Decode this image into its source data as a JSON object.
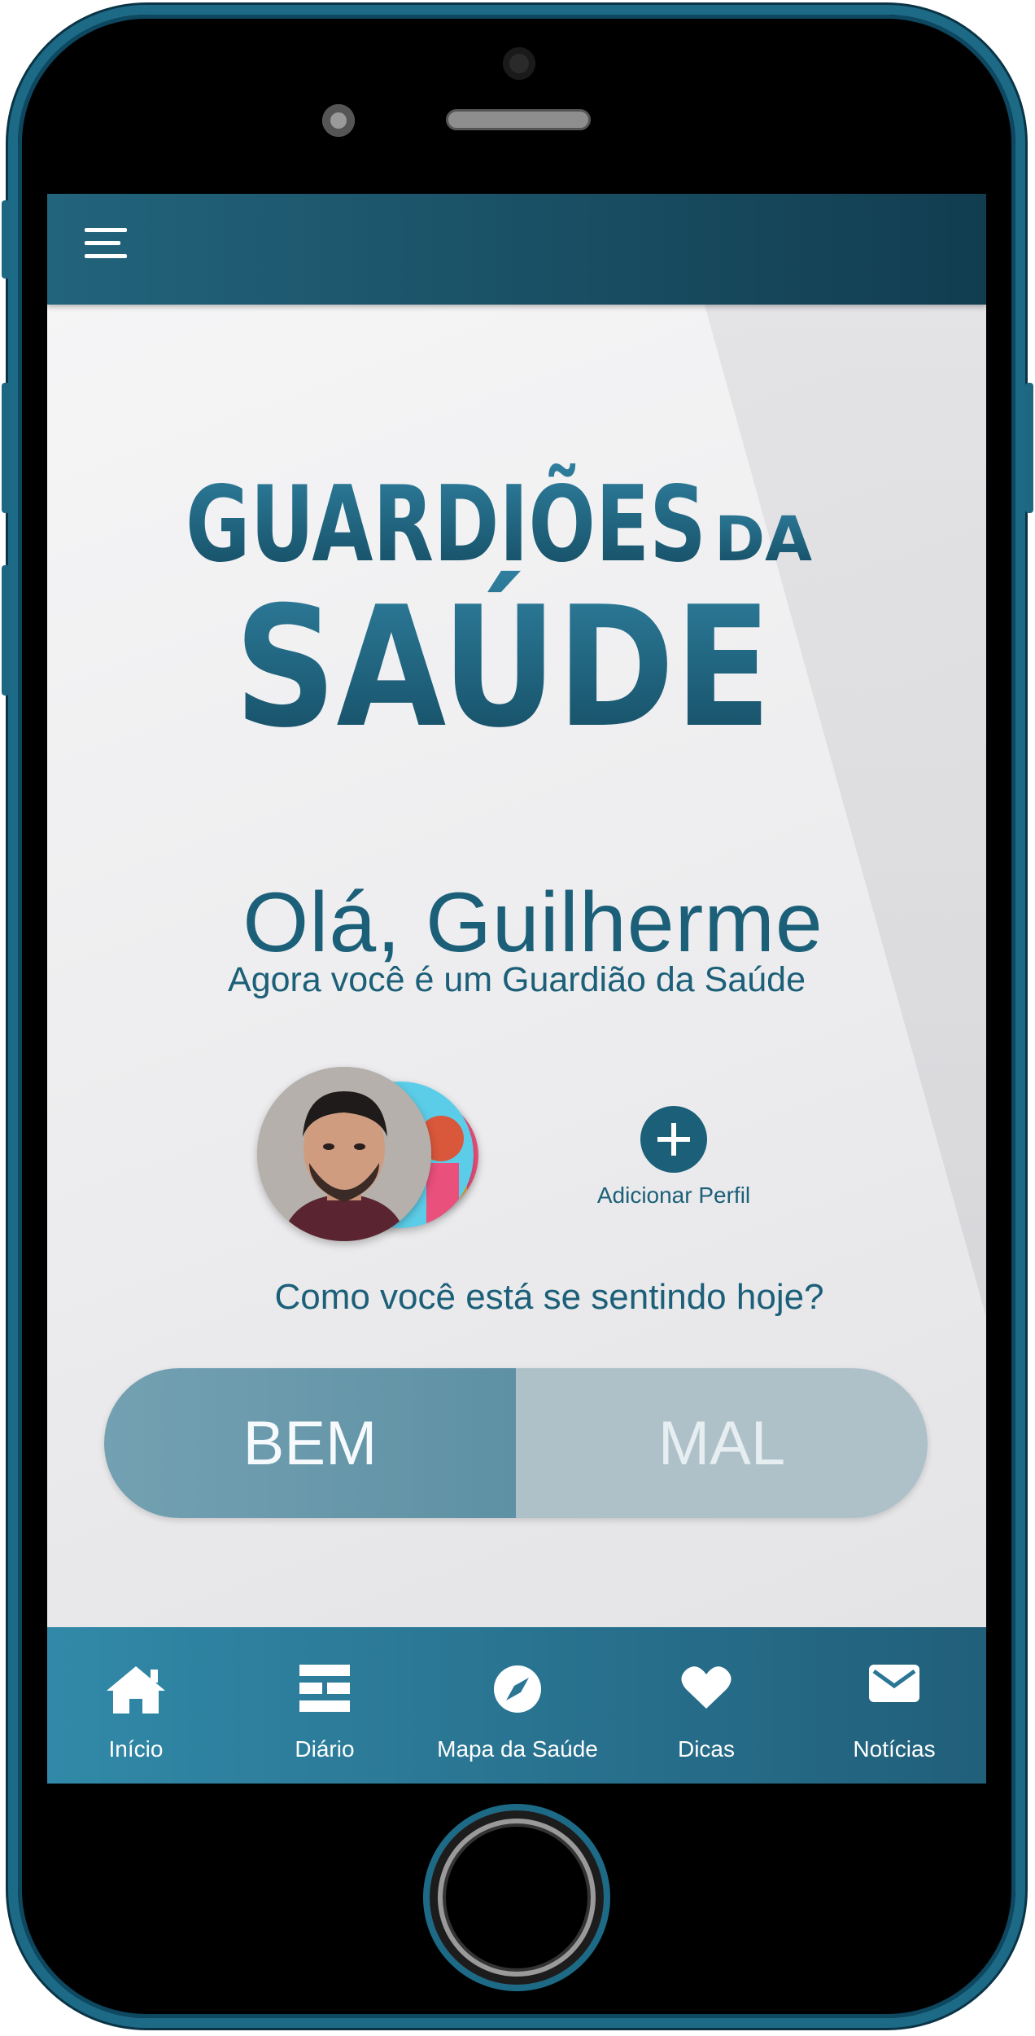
{
  "app": {
    "logo_text_line1": "GUARDIÕES",
    "logo_text_da": "DA",
    "logo_text_line2": "SAÚDE"
  },
  "header": {
    "menu_icon": "hamburger-menu-icon"
  },
  "greeting": {
    "hello": "Olá, Guilherme",
    "subtitle": "Agora você é um Guardião da Saúde"
  },
  "profiles": {
    "add_label": "Adicionar Perfil",
    "add_icon": "plus-circle-icon"
  },
  "mood": {
    "question": "Como você está se sentindo hoje?",
    "good_label": "BEM",
    "bad_label": "MAL"
  },
  "tabs": [
    {
      "label": "Início",
      "icon": "home-icon"
    },
    {
      "label": "Diário",
      "icon": "list-icon"
    },
    {
      "label": "Mapa da Saúde",
      "icon": "compass-icon"
    },
    {
      "label": "Dicas",
      "icon": "heart-icon"
    },
    {
      "label": "Notícias",
      "icon": "mail-icon"
    }
  ],
  "colors": {
    "primary": "#1b5f78",
    "topbar_dark": "#123d50",
    "tabbar": "#2a7694",
    "phone_frame": "#1d6a86"
  }
}
